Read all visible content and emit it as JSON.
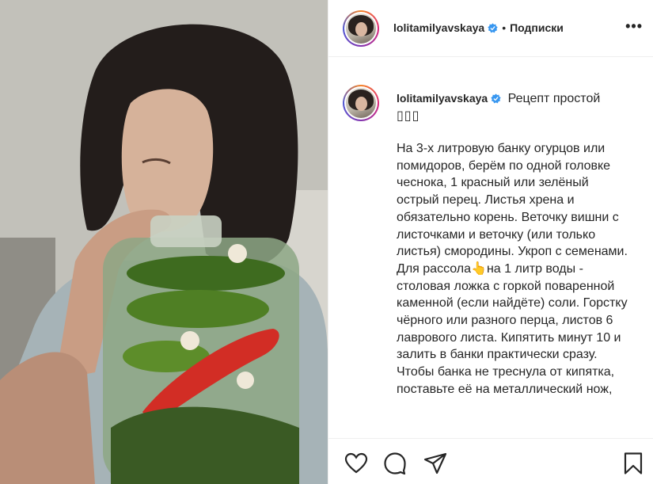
{
  "post": {
    "author": "lolitamilyavskaya",
    "separator": "•",
    "follow_label": "Подписки",
    "more_label": "•••"
  },
  "caption": {
    "author": "lolitamilyavskaya",
    "headline": "Рецепт простой",
    "emoji": "▯▯▯",
    "body": "На 3-х литровую банку огурцов или помидоров, берём по одной головке чеснока, 1 красный или зелёный острый перец. Листья хрена и обязательно корень. Веточку вишни с листочками и веточку (или только листья) смородины. Укроп с семенами.\nДля рассола👆на 1 литр воды - столовая ложка с горкой поваренной каменной (если найдёте) соли. Горстку чёрного или разного перца, листов 6 лаврового листа. Кипятить минут 10 и залить в банки практически сразу. Чтобы банка не треснула от кипятка, поставьте её на металлический нож,"
  },
  "icons": [
    "heart-icon",
    "comment-icon",
    "share-icon",
    "bookmark-icon",
    "verified-icon",
    "more-icon"
  ],
  "colors": {
    "verified": "#3897f0",
    "text": "#262626",
    "border": "#efefef"
  }
}
